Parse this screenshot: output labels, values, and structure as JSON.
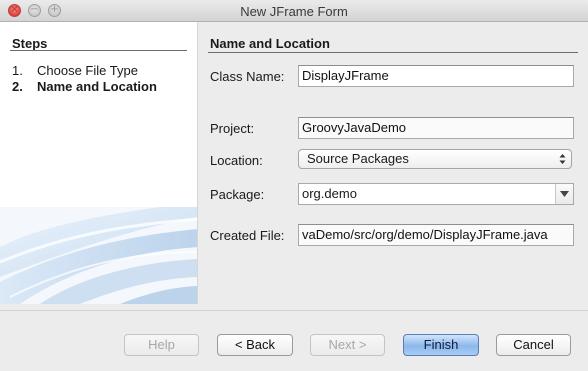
{
  "window": {
    "title": "New JFrame Form"
  },
  "steps": {
    "heading": "Steps",
    "items": [
      {
        "number": "1.",
        "label": "Choose File Type",
        "current": false
      },
      {
        "number": "2.",
        "label": "Name and Location",
        "current": true
      }
    ]
  },
  "form": {
    "section_title": "Name and Location",
    "class_name": {
      "label": "Class Name:",
      "value": "DisplayJFrame"
    },
    "project": {
      "label": "Project:",
      "value": "GroovyJavaDemo"
    },
    "location": {
      "label": "Location:",
      "value": "Source Packages"
    },
    "package": {
      "label": "Package:",
      "value": "org.demo"
    },
    "created_file": {
      "label": "Created File:",
      "value": "vaDemo/src/org/demo/DisplayJFrame.java"
    }
  },
  "buttons": {
    "help": "Help",
    "back": "< Back",
    "next": "Next >",
    "finish": "Finish",
    "cancel": "Cancel"
  },
  "colors": {
    "default_button": "#8db8ec",
    "window_bg": "#ececec",
    "steps_bg": "#ffffff",
    "close_button": "#e0443e"
  }
}
